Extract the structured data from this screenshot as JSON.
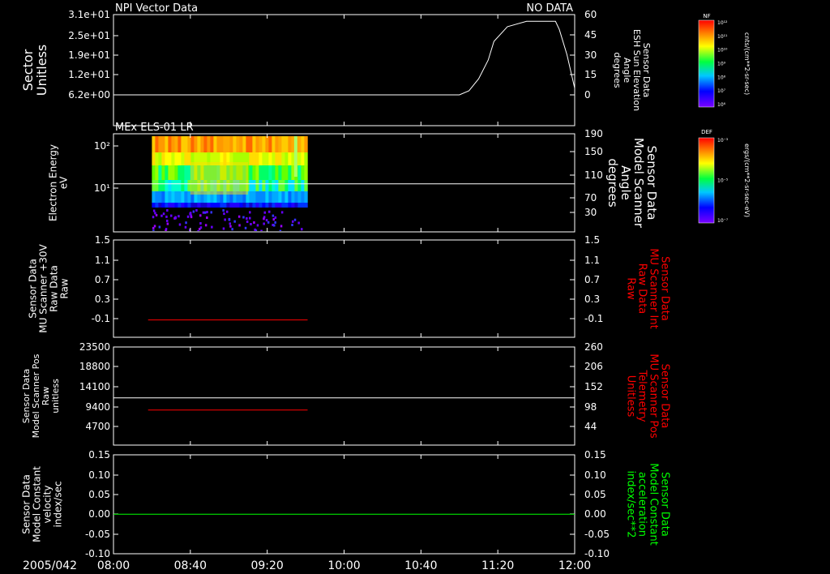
{
  "chart_data": [
    {
      "type": "line",
      "title": "NPI Vector Data",
      "status": "NO DATA",
      "ylabel_left": [
        "Sector",
        "Unitless"
      ],
      "ylabel_right": [
        "Sensor Data",
        "ESH Sun Elevation",
        "Angle",
        "degrees"
      ],
      "left_ticks": [
        "3.1e+01",
        "2.5e+01",
        "1.9e+01",
        "1.2e+01",
        "6.2e+00"
      ],
      "right_ticks": [
        "60",
        "45",
        "30",
        "15",
        "0"
      ],
      "ylim_right": [
        -15,
        60
      ],
      "series": [
        {
          "color": "#ffffff",
          "x": [
            "08:00",
            "11:00",
            "11:05",
            "11:10",
            "11:15",
            "11:18",
            "11:25",
            "11:35",
            "11:45",
            "11:50",
            "11:52",
            "11:56",
            "12:00"
          ],
          "values": [
            0,
            0,
            3,
            12,
            26,
            40,
            51,
            55,
            55,
            55,
            49,
            30,
            5
          ]
        },
        {
          "color": "#ffffff",
          "x": [
            "08:00",
            "11:00"
          ],
          "values": [
            0,
            0
          ]
        }
      ]
    },
    {
      "type": "heatmap",
      "title": "MEx ELS-01 LR",
      "ylabel_left": [
        "Electron Energy",
        "eV"
      ],
      "ylabel_right": [
        "Sensor Data",
        "Model Scanner",
        "Angle",
        "degrees"
      ],
      "left_ticks": [
        "10²",
        "10¹"
      ],
      "right_ticks": [
        "190",
        "150",
        "110",
        "70",
        "30"
      ],
      "ylim_right": [
        0,
        190
      ],
      "data_extent": [
        "08:20",
        "09:40"
      ],
      "line_series": {
        "color": "#ffffff",
        "x": [
          "08:00",
          "12:00"
        ],
        "values": [
          93,
          93
        ]
      }
    },
    {
      "type": "line",
      "ylabel_left": [
        "Sensor Data",
        "MU Scanner +30V",
        "Raw Data",
        "Raw"
      ],
      "ylabel_right": [
        "Sensor Data",
        "MU Scanner Int",
        "Raw Data",
        "Raw"
      ],
      "left_ticks": [
        "1.5",
        "1.1",
        "0.7",
        "0.3",
        "-0.1"
      ],
      "right_ticks": [
        "1.5",
        "1.1",
        "0.7",
        "0.3",
        "-0.1"
      ],
      "ylim": [
        -0.35,
        1.5
      ],
      "series": [
        {
          "color": "#ff0000",
          "x": [
            "08:18",
            "09:41"
          ],
          "values": [
            -0.02,
            -0.02
          ]
        }
      ]
    },
    {
      "type": "line",
      "ylabel_left": [
        "Sensor Data",
        "Model Scanner Pos",
        "Raw",
        "unitless"
      ],
      "ylabel_right": [
        "Sensor Data",
        "MU Scanner Pos",
        "Telemetry",
        "Unitless"
      ],
      "left_ticks": [
        "23500",
        "18800",
        "14100",
        "9400",
        "4700"
      ],
      "right_ticks": [
        "260",
        "206",
        "152",
        "98",
        "44"
      ],
      "ylim": [
        0,
        23500
      ],
      "ylim_right": [
        0,
        260
      ],
      "series": [
        {
          "color": "#ffffff",
          "x": [
            "08:00",
            "12:00"
          ],
          "values": [
            11300,
            11300
          ]
        },
        {
          "color": "#ff0000",
          "x": [
            "08:18",
            "09:41"
          ],
          "values": [
            8400,
            8400
          ]
        }
      ]
    },
    {
      "type": "line",
      "ylabel_left": [
        "Sensor Data",
        "Model Constant",
        "velocity",
        "index/sec"
      ],
      "ylabel_right": [
        "Sensor Data",
        "Model Constant",
        "acceleration",
        "index/sec**2"
      ],
      "left_ticks": [
        "0.15",
        "0.10",
        "0.05",
        "0.00",
        "-0.05",
        "-0.10"
      ],
      "right_ticks": [
        "0.15",
        "0.10",
        "0.05",
        "0.00",
        "-0.05",
        "-0.10"
      ],
      "ylim": [
        -0.1,
        0.15
      ],
      "series": [
        {
          "color": "#00ff00",
          "x": [
            "08:00",
            "12:00"
          ],
          "values": [
            0,
            0
          ]
        }
      ]
    }
  ],
  "xaxis": {
    "date_label": "2005/042",
    "ticks": [
      "08:00",
      "08:40",
      "09:20",
      "10:00",
      "10:40",
      "11:20",
      "12:00"
    ],
    "range": [
      "08:00",
      "12:00"
    ]
  },
  "colorbars": [
    {
      "title": "NF",
      "unit": "cnts/(cm**2-sr-sec)",
      "ticks": [
        "10¹²",
        "10¹¹",
        "10¹⁰",
        "10⁹",
        "10⁸",
        "10⁷",
        "10⁶"
      ]
    },
    {
      "title": "DEF",
      "unit": "ergs/(cm**2-sr-sec-eV)",
      "ticks": [
        "10⁻³",
        "10⁻⁵",
        "10⁻⁷"
      ]
    }
  ],
  "colors": {
    "background": "#000000",
    "axes": "#ffffff",
    "red_label": "#ff0000",
    "green_label": "#00ff00"
  }
}
